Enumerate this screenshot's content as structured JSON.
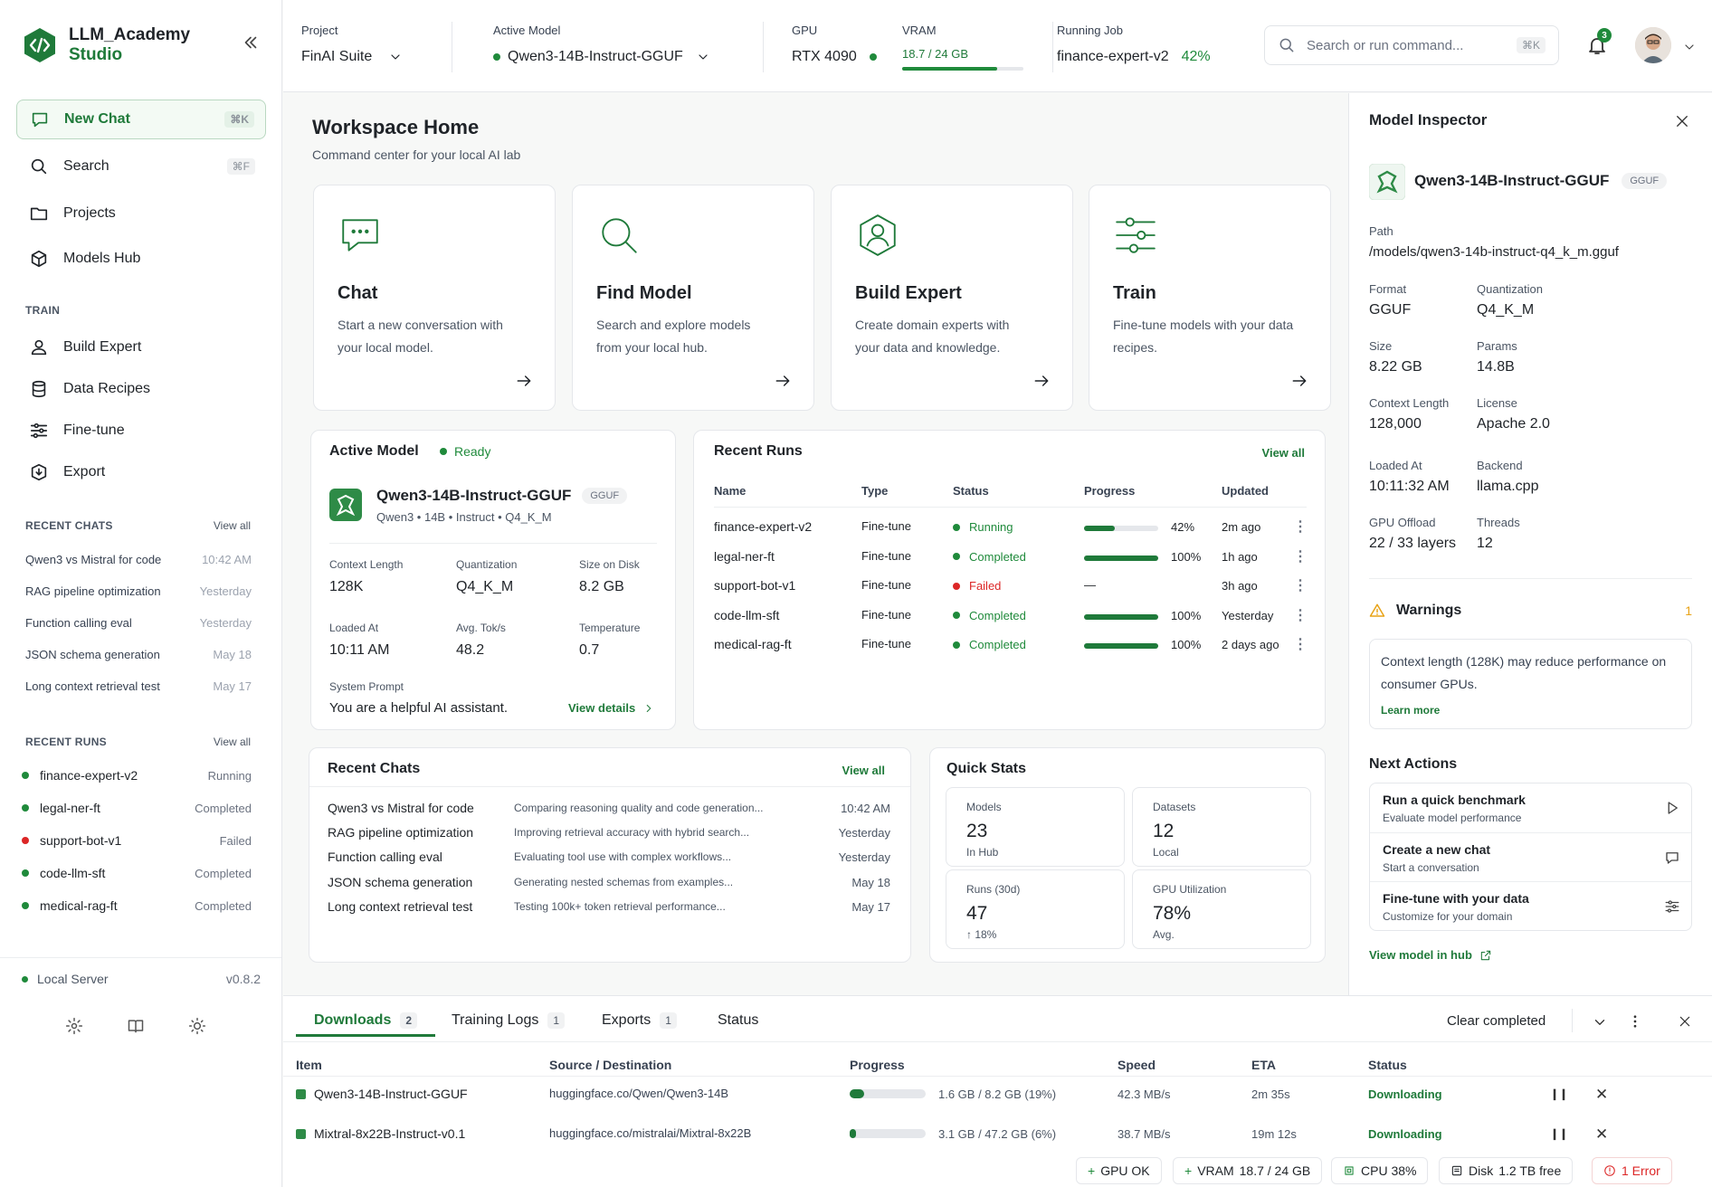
{
  "brand": {
    "line1": "LLM_Academy",
    "line2": "Studio"
  },
  "sidebar": {
    "nav": [
      {
        "label": "New Chat",
        "kbd": "⌘K"
      },
      {
        "label": "Search",
        "kbd": "⌘F"
      },
      {
        "label": "Projects"
      },
      {
        "label": "Models Hub"
      }
    ],
    "train_title": "TRAIN",
    "train": [
      {
        "label": "Build Expert"
      },
      {
        "label": "Data Recipes"
      },
      {
        "label": "Fine-tune"
      },
      {
        "label": "Export"
      }
    ],
    "recent_chats_title": "RECENT CHATS",
    "recent_chats_viewall": "View all",
    "recent_chats": [
      {
        "title": "Qwen3 vs Mistral for code",
        "time": "10:42 AM"
      },
      {
        "title": "RAG pipeline optimization",
        "time": "Yesterday"
      },
      {
        "title": "Function calling eval",
        "time": "Yesterday"
      },
      {
        "title": "JSON schema generation",
        "time": "May 18"
      },
      {
        "title": "Long context retrieval test",
        "time": "May 17"
      }
    ],
    "recent_runs_title": "RECENT RUNS",
    "recent_runs_viewall": "View all",
    "recent_runs": [
      {
        "name": "finance-expert-v2",
        "status": "Running"
      },
      {
        "name": "legal-ner-ft",
        "status": "Completed"
      },
      {
        "name": "support-bot-v1",
        "status": "Failed"
      },
      {
        "name": "code-llm-sft",
        "status": "Completed"
      },
      {
        "name": "medical-rag-ft",
        "status": "Completed"
      }
    ],
    "server_label": "Local Server",
    "version": "v0.8.2"
  },
  "topbar": {
    "project_label": "Project",
    "project": "FinAI Suite",
    "model_label": "Active Model",
    "model": "Qwen3-14B-Instruct-GGUF",
    "gpu_label": "GPU",
    "gpu": "RTX 4090",
    "vram_label": "VRAM",
    "vram": "18.7 / 24 GB",
    "vram_fraction": 0.78,
    "job_label": "Running Job",
    "job": "finance-expert-v2",
    "job_progress": "42%",
    "search_placeholder": "Search or run command...",
    "search_kbd": "⌘K",
    "notifications": "3"
  },
  "main": {
    "title": "Workspace Home",
    "subtitle": "Command center for your local AI lab",
    "quick_actions": [
      {
        "title": "Chat",
        "desc": "Start a new conversation with your local model.",
        "icon": "chat-icon"
      },
      {
        "title": "Find Model",
        "desc": "Search and explore models from your local hub.",
        "icon": "search-icon"
      },
      {
        "title": "Build Expert",
        "desc": "Create domain experts with your data and knowledge.",
        "icon": "expert-icon"
      },
      {
        "title": "Train",
        "desc": "Fine-tune models with your data recipes.",
        "icon": "sliders-icon"
      }
    ],
    "active_model": {
      "title": "Active Model",
      "status": "Ready",
      "name": "Qwen3-14B-Instruct-GGUF",
      "badge": "GGUF",
      "meta": "Qwen3 • 14B • Instruct • Q4_K_M",
      "context_label": "Context Length",
      "context": "128K",
      "quant_label": "Quantization",
      "quant": "Q4_K_M",
      "size_label": "Size on Disk",
      "size": "8.2 GB",
      "loaded_label": "Loaded At",
      "loaded": "10:11 AM",
      "tok_label": "Avg. Tok/s",
      "tok": "48.2",
      "temp_label": "Temperature",
      "temp": "0.7",
      "prompt_label": "System Prompt",
      "prompt": "You are a helpful AI assistant.",
      "details_link": "View details"
    },
    "recent_runs": {
      "title": "Recent Runs",
      "viewall": "View all",
      "headers": {
        "name": "Name",
        "type": "Type",
        "status": "Status",
        "progress": "Progress",
        "updated": "Updated"
      },
      "rows": [
        {
          "name": "finance-expert-v2",
          "type": "Fine-tune",
          "status": "Running",
          "progress": 0.42,
          "progress_text": "42%",
          "updated": "2m ago"
        },
        {
          "name": "legal-ner-ft",
          "type": "Fine-tune",
          "status": "Completed",
          "progress": 1,
          "progress_text": "100%",
          "updated": "1h ago"
        },
        {
          "name": "support-bot-v1",
          "type": "Fine-tune",
          "status": "Failed",
          "progress": null,
          "progress_text": "—",
          "updated": "3h ago"
        },
        {
          "name": "code-llm-sft",
          "type": "Fine-tune",
          "status": "Completed",
          "progress": 1,
          "progress_text": "100%",
          "updated": "Yesterday"
        },
        {
          "name": "medical-rag-ft",
          "type": "Fine-tune",
          "status": "Completed",
          "progress": 1,
          "progress_text": "100%",
          "updated": "2 days ago"
        }
      ]
    },
    "recent_chats": {
      "title": "Recent Chats",
      "viewall": "View all",
      "rows": [
        {
          "title": "Qwen3 vs Mistral for code",
          "snippet": "Comparing reasoning quality and code generation...",
          "time": "10:42 AM"
        },
        {
          "title": "RAG pipeline optimization",
          "snippet": "Improving retrieval accuracy with hybrid search...",
          "time": "Yesterday"
        },
        {
          "title": "Function calling eval",
          "snippet": "Evaluating tool use with complex workflows...",
          "time": "Yesterday"
        },
        {
          "title": "JSON schema generation",
          "snippet": "Generating nested schemas from examples...",
          "time": "May 18"
        },
        {
          "title": "Long context retrieval test",
          "snippet": "Testing 100k+ token retrieval performance...",
          "time": "May 17"
        }
      ]
    },
    "quick_stats": {
      "title": "Quick Stats",
      "items": [
        {
          "label": "Models",
          "value": "23",
          "sub": "In Hub"
        },
        {
          "label": "Datasets",
          "value": "12",
          "sub": "Local"
        },
        {
          "label": "Runs (30d)",
          "value": "47",
          "sub": "↑ 18%"
        },
        {
          "label": "GPU Utilization",
          "value": "78%",
          "sub": "Avg."
        }
      ]
    }
  },
  "inspector": {
    "title": "Model Inspector",
    "model": "Qwen3-14B-Instruct-GGUF",
    "badge": "GGUF",
    "path_label": "Path",
    "path": "/models/qwen3-14b-instruct-q4_k_m.gguf",
    "format_label": "Format",
    "format": "GGUF",
    "quant_label": "Quantization",
    "quant": "Q4_K_M",
    "size_label": "Size",
    "size": "8.22 GB",
    "params_label": "Params",
    "params": "14.8B",
    "ctx_label": "Context Length",
    "ctx": "128,000",
    "license_label": "License",
    "license": "Apache 2.0",
    "loaded_label": "Loaded At",
    "loaded": "10:11:32 AM",
    "backend_label": "Backend",
    "backend": "llama.cpp",
    "offload_label": "GPU Offload",
    "offload": "22 / 33 layers",
    "threads_label": "Threads",
    "threads": "12",
    "warnings_title": "Warnings",
    "warnings_count": "1",
    "warning_text": "Context length (128K) may reduce performance on consumer GPUs.",
    "learn_more": "Learn more",
    "next_title": "Next Actions",
    "next_actions": [
      {
        "title": "Run a quick benchmark",
        "desc": "Evaluate model performance"
      },
      {
        "title": "Create a new chat",
        "desc": "Start a conversation"
      },
      {
        "title": "Fine-tune with your data",
        "desc": "Customize for your domain"
      }
    ],
    "hub_link": "View model in hub"
  },
  "bottom": {
    "tabs": [
      {
        "label": "Downloads",
        "count": "2"
      },
      {
        "label": "Training Logs",
        "count": "1"
      },
      {
        "label": "Exports",
        "count": "1"
      },
      {
        "label": "Status"
      }
    ],
    "clear": "Clear completed",
    "headers": {
      "item": "Item",
      "source": "Source / Destination",
      "progress": "Progress",
      "speed": "Speed",
      "eta": "ETA",
      "status": "Status"
    },
    "rows": [
      {
        "item": "Qwen3-14B-Instruct-GGUF",
        "source": "huggingface.co/Qwen/Qwen3-14B",
        "progress": 0.19,
        "progress_text": "1.6 GB / 8.2 GB (19%)",
        "speed": "42.3 MB/s",
        "eta": "2m 35s",
        "status": "Downloading"
      },
      {
        "item": "Mixtral-8x22B-Instruct-v0.1",
        "source": "huggingface.co/mistralai/Mixtral-8x22B",
        "progress": 0.06,
        "progress_text": "3.1 GB / 47.2 GB (6%)",
        "speed": "38.7 MB/s",
        "eta": "19m 12s",
        "status": "Downloading"
      }
    ],
    "chips": {
      "gpu": "GPU OK",
      "vram_label": "VRAM",
      "vram": "18.7 / 24 GB",
      "cpu": "CPU 38%",
      "disk_label": "Disk",
      "disk": "1.2 TB free",
      "error": "1 Error"
    }
  },
  "colors": {
    "accent": "#1f7a3a",
    "success": "#1f8a3b",
    "danger": "#dc2626",
    "warning": "#e8a317"
  }
}
